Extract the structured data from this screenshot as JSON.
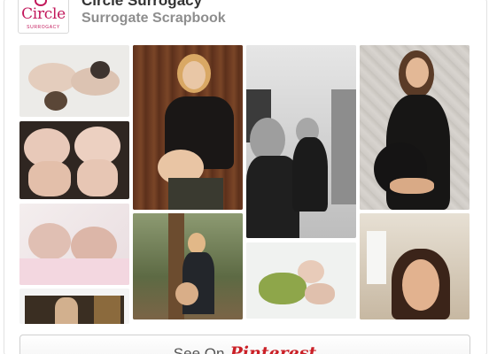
{
  "header": {
    "logo_text": "Circle",
    "logo_subtext": "SURROGACY",
    "owner_name": "Circle Surrogacy",
    "board_title": "Surrogate Scrapbook"
  },
  "pins": [
    {
      "name": "pin-twin-babies-on-blanket",
      "alt": "Two babies lying on a white blanket"
    },
    {
      "name": "pin-twin-newborns-dark-blanket",
      "alt": "Twin newborns on a dark fur blanket"
    },
    {
      "name": "pin-sleeping-newborns",
      "alt": "Two sleeping newborns in pink"
    },
    {
      "name": "pin-woman-window",
      "alt": "Woman smiling near a window"
    },
    {
      "name": "pin-pregnant-woman-wood-wall",
      "alt": "Pregnant woman in front of wooden wall"
    },
    {
      "name": "pin-pregnant-woman-outdoors",
      "alt": "Pregnant woman standing outdoors among trees"
    },
    {
      "name": "pin-couple-selfie-bw",
      "alt": "Black and white selfie of couple"
    },
    {
      "name": "pin-newborns-green-wrap",
      "alt": "Newborns wrapped in green"
    },
    {
      "name": "pin-pregnant-woman-black-dress",
      "alt": "Pregnant woman in black dress"
    },
    {
      "name": "pin-woman-portrait-home",
      "alt": "Smiling woman portrait at home"
    }
  ],
  "footer": {
    "see_on_label": "See On",
    "brand_name": "Pinterest"
  },
  "colors": {
    "brand": "#cb2027",
    "logo": "#c2185b"
  }
}
